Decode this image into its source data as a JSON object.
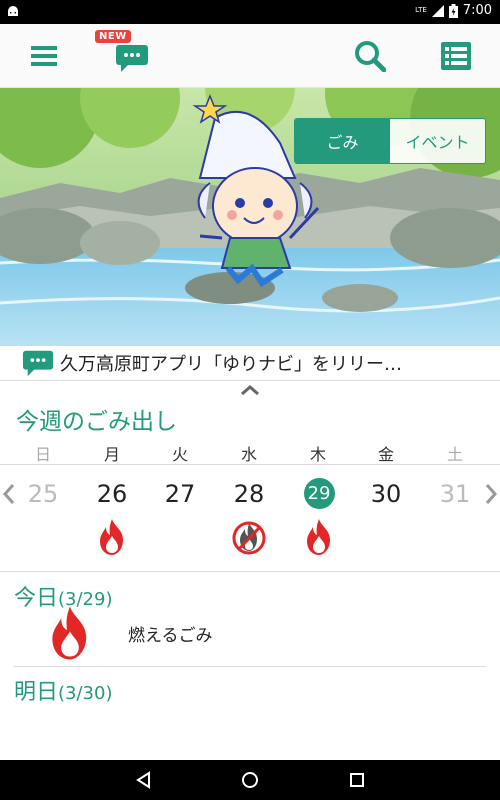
{
  "status_bar": {
    "network": "LTE",
    "time": "7:00"
  },
  "app_bar": {
    "new_badge": "NEW"
  },
  "hero": {
    "toggle": [
      "ごみ",
      "イベント"
    ],
    "active_index": 0
  },
  "news": {
    "text": "久万高原町アプリ「ゆりナビ」をリリー…"
  },
  "week": {
    "title": "今週のごみ出し",
    "days": [
      "日",
      "月",
      "火",
      "水",
      "木",
      "金",
      "土"
    ],
    "dates": [
      "25",
      "26",
      "27",
      "28",
      "29",
      "30",
      "31"
    ],
    "today_index": 4,
    "collections": [
      {
        "day_index": 1,
        "type": "burnable-icon"
      },
      {
        "day_index": 3,
        "type": "no-burnable-icon"
      },
      {
        "day_index": 4,
        "type": "burnable-icon"
      }
    ]
  },
  "today": {
    "title": "今日",
    "date": "(3/29)",
    "item": "燃えるごみ"
  },
  "tomorrow": {
    "title": "明日",
    "date": "(3/30)"
  },
  "colors": {
    "accent": "#239a7c",
    "fire": "#e32727",
    "badge": "#e8433c"
  }
}
